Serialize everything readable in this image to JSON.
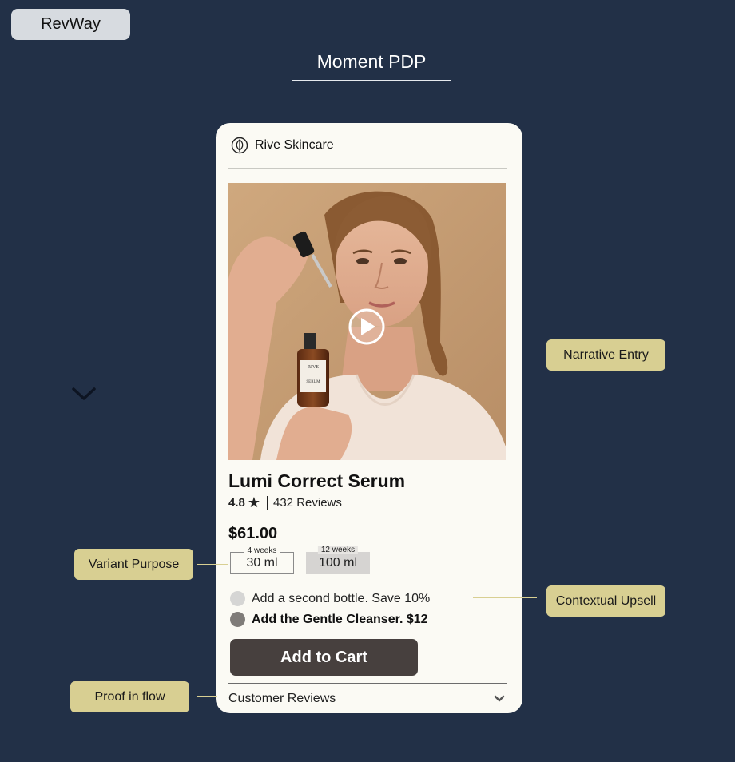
{
  "brand": {
    "label": "RevWay"
  },
  "page": {
    "title": "Moment PDP"
  },
  "store": {
    "name": "Rive Skincare"
  },
  "product": {
    "name": "Lumi Correct Serum",
    "rating": "4.8",
    "rating_icon": "star-icon",
    "reviews_count": "432 Reviews",
    "price": "$61.00",
    "bottle_label_brand": "RIVE",
    "bottle_label_type": "SERUM",
    "variants": [
      {
        "tag": "4 weeks",
        "label": "30 ml",
        "selected": true
      },
      {
        "tag": "12 weeks",
        "label": "100 ml",
        "selected": false
      }
    ],
    "upsells": [
      {
        "label": "Add a second bottle. Save 10%",
        "selected": false
      },
      {
        "label": "Add the Gentle Cleanser. $12",
        "selected": true
      }
    ],
    "add_to_cart_label": "Add to Cart",
    "reviews_section_label": "Customer Reviews"
  },
  "annotations": {
    "narrative_entry": "Narrative Entry",
    "variant_purpose": "Variant Purpose",
    "contextual_upsell": "Contextual Upsell",
    "proof_in_flow": "Proof in flow"
  },
  "colors": {
    "background": "#223047",
    "card": "#fbfaf4",
    "annotation": "#d8cf92",
    "cta": "#47403e"
  }
}
